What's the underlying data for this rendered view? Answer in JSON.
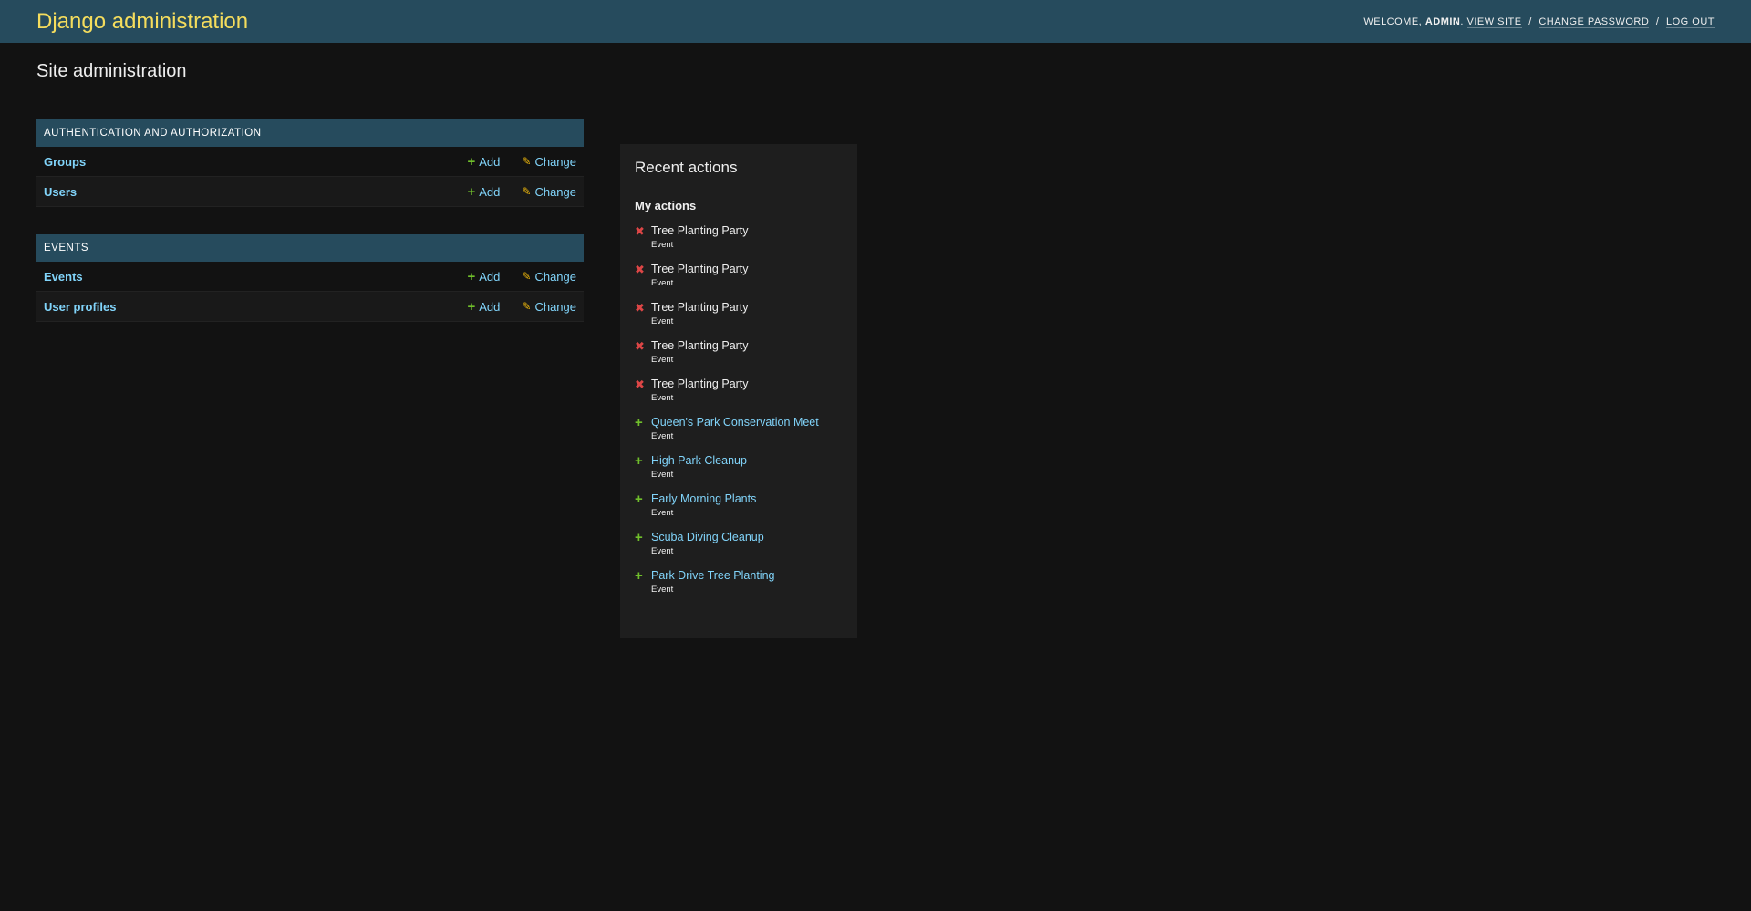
{
  "header": {
    "branding": "Django administration",
    "welcome": "Welcome,",
    "username": "admin",
    "view_site": "View site",
    "change_password": "Change password",
    "log_out": "Log out"
  },
  "page_title": "Site administration",
  "apps": [
    {
      "caption": "Authentication and Authorization",
      "models": [
        {
          "name": "Groups",
          "add": "Add",
          "change": "Change"
        },
        {
          "name": "Users",
          "add": "Add",
          "change": "Change"
        }
      ]
    },
    {
      "caption": "Events",
      "models": [
        {
          "name": "Events",
          "add": "Add",
          "change": "Change"
        },
        {
          "name": "User profiles",
          "add": "Add",
          "change": "Change"
        }
      ]
    }
  ],
  "recent": {
    "title": "Recent actions",
    "subtitle": "My actions",
    "items": [
      {
        "name": "Tree Planting Party",
        "type": "Event",
        "action": "delete"
      },
      {
        "name": "Tree Planting Party",
        "type": "Event",
        "action": "delete"
      },
      {
        "name": "Tree Planting Party",
        "type": "Event",
        "action": "delete"
      },
      {
        "name": "Tree Planting Party",
        "type": "Event",
        "action": "delete"
      },
      {
        "name": "Tree Planting Party",
        "type": "Event",
        "action": "delete"
      },
      {
        "name": "Queen's Park Conservation Meet",
        "type": "Event",
        "action": "add"
      },
      {
        "name": "High Park Cleanup",
        "type": "Event",
        "action": "add"
      },
      {
        "name": "Early Morning Plants",
        "type": "Event",
        "action": "add"
      },
      {
        "name": "Scuba Diving Cleanup",
        "type": "Event",
        "action": "add"
      },
      {
        "name": "Park Drive Tree Planting",
        "type": "Event",
        "action": "add"
      }
    ]
  },
  "colors": {
    "header_bg": "#264b5d",
    "branding": "#f5dd5d",
    "link": "#81d4fa",
    "add_icon": "#70bf2b",
    "change_icon": "#efb80b",
    "delete_icon": "#dd4646"
  },
  "icons": {
    "add": "plus-icon",
    "change": "pencil-icon",
    "delete": "x-icon"
  }
}
